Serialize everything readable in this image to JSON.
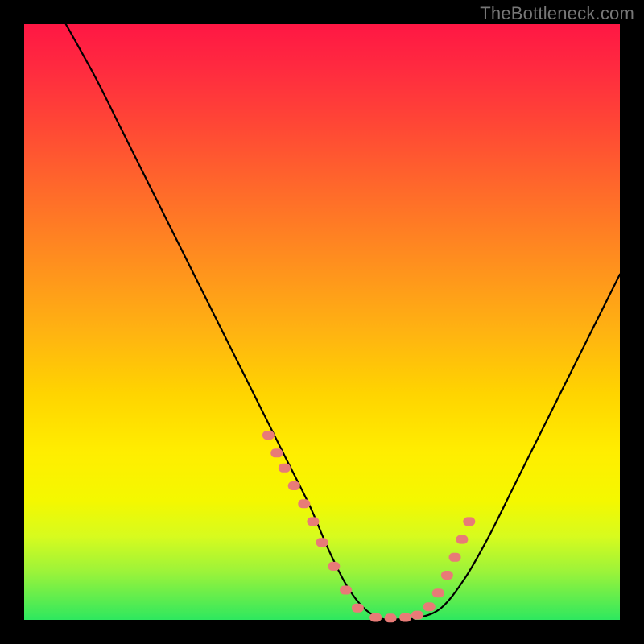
{
  "watermark": "TheBottleneck.com",
  "colors": {
    "background": "#000000",
    "curve": "#000000",
    "dot": "#e87b77",
    "gradient_top": "#ff1744",
    "gradient_bottom": "#2ee85f"
  },
  "chart_data": {
    "type": "line",
    "title": "",
    "xlabel": "",
    "ylabel": "",
    "xlim": [
      0,
      100
    ],
    "ylim": [
      0,
      100
    ],
    "grid": false,
    "legend": false,
    "series": [
      {
        "name": "bottleneck-curve",
        "x": [
          7,
          12,
          16,
          20,
          24,
          28,
          32,
          36,
          40,
          44,
          48,
          51,
          54,
          57,
          60,
          63,
          66,
          70,
          74,
          78,
          82,
          86,
          90,
          94,
          98,
          100
        ],
        "y": [
          100,
          91,
          83,
          75,
          67,
          59,
          51,
          43,
          35,
          27,
          19,
          12,
          6,
          2,
          0.2,
          0.1,
          0.3,
          2,
          7,
          14,
          22,
          30,
          38,
          46,
          54,
          58
        ]
      }
    ],
    "markers": {
      "name": "highlight-dots",
      "x": [
        41,
        42.4,
        43.7,
        45.3,
        47,
        48.5,
        50,
        52,
        54,
        56,
        59,
        61.5,
        64,
        66,
        68,
        69.5,
        71,
        72.3,
        73.5,
        74.7
      ],
      "y": [
        31,
        28,
        25.5,
        22.5,
        19.5,
        16.5,
        13,
        9,
        5,
        2,
        0.4,
        0.3,
        0.4,
        0.8,
        2.2,
        4.5,
        7.5,
        10.5,
        13.5,
        16.5
      ]
    }
  }
}
